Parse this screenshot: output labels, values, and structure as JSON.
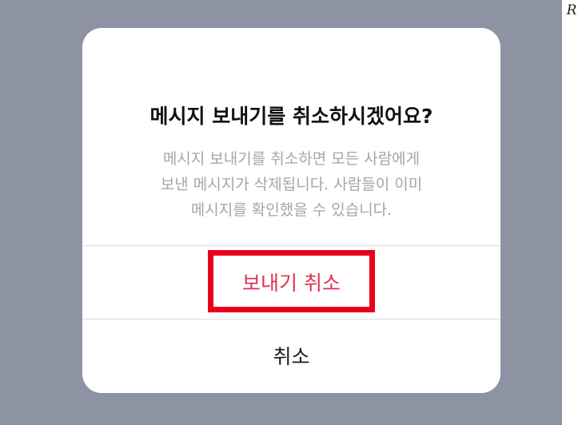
{
  "watermark": "R",
  "dialog": {
    "title": "메시지 보내기를 취소하시겠어요?",
    "message_lines": [
      "메시지 보내기를 취소하면 모든 사람에게",
      "보낸 메시지가 삭제됩니다. 사람들이 이미",
      "메시지를 확인했을 수 있습니다."
    ],
    "actions": {
      "unsend_label": "보내기 취소",
      "cancel_label": "취소"
    }
  },
  "colors": {
    "backdrop": "#8e93a4",
    "destructive": "#e0334f",
    "highlight": "#e8001c",
    "secondary_text": "#a6a6ab"
  }
}
